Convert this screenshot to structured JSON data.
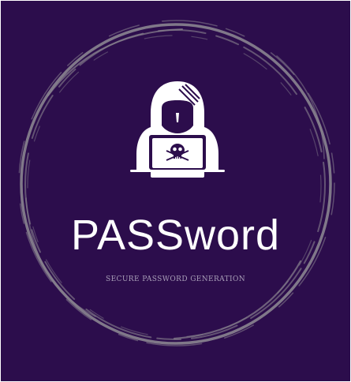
{
  "logo": {
    "title": "PASSword",
    "tagline": "SECURE PASSWORD GENERATION",
    "icon": "hooded-hacker-with-skull-laptop-icon",
    "colors": {
      "background": "#2c0d4c",
      "ring": "#8a8490",
      "text": "#ffffff",
      "tagline": "#a99fb8"
    }
  }
}
